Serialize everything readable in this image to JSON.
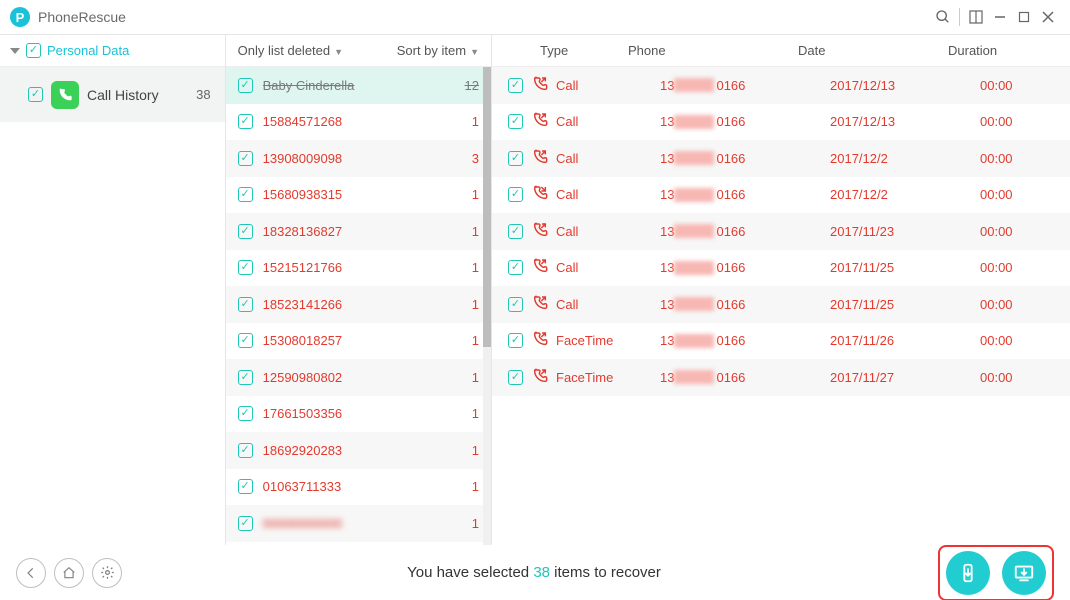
{
  "app": {
    "title": "PhoneRescue"
  },
  "sidebar": {
    "root_label": "Personal Data",
    "item": {
      "label": "Call History",
      "count": "38"
    }
  },
  "middle": {
    "filter_label": "Only list deleted",
    "sort_label": "Sort by item",
    "rows": [
      {
        "name": "Baby Cinderella",
        "count": "12",
        "selected": true
      },
      {
        "name": "15884571268",
        "count": "1"
      },
      {
        "name": "13908009098",
        "count": "3"
      },
      {
        "name": "15680938315",
        "count": "1"
      },
      {
        "name": "18328136827",
        "count": "1"
      },
      {
        "name": "15215121766",
        "count": "1"
      },
      {
        "name": "18523141266",
        "count": "1"
      },
      {
        "name": "15308018257",
        "count": "1"
      },
      {
        "name": "12590980802",
        "count": "1"
      },
      {
        "name": "17661503356",
        "count": "1"
      },
      {
        "name": "18692920283",
        "count": "1"
      },
      {
        "name": "01063711333",
        "count": "1"
      },
      {
        "name": "",
        "count": "1",
        "blurred": true
      }
    ]
  },
  "detail": {
    "headers": {
      "type": "Type",
      "phone": "Phone",
      "date": "Date",
      "duration": "Duration"
    },
    "rows": [
      {
        "type": "Call",
        "dir": "out",
        "pfx": "13",
        "sfx": "0166",
        "date": "2017/12/13",
        "dur": "00:00"
      },
      {
        "type": "Call",
        "dir": "out",
        "pfx": "13",
        "sfx": "0166",
        "date": "2017/12/13",
        "dur": "00:00"
      },
      {
        "type": "Call",
        "dir": "out",
        "pfx": "13",
        "sfx": "0166",
        "date": "2017/12/2",
        "dur": "00:00"
      },
      {
        "type": "Call",
        "dir": "missed",
        "pfx": "13",
        "sfx": "0166",
        "date": "2017/12/2",
        "dur": "00:00"
      },
      {
        "type": "Call",
        "dir": "out",
        "pfx": "13",
        "sfx": "0166",
        "date": "2017/11/23",
        "dur": "00:00"
      },
      {
        "type": "Call",
        "dir": "out",
        "pfx": "13",
        "sfx": "0166",
        "date": "2017/11/25",
        "dur": "00:00"
      },
      {
        "type": "Call",
        "dir": "out",
        "pfx": "13",
        "sfx": "0166",
        "date": "2017/11/25",
        "dur": "00:00"
      },
      {
        "type": "FaceTime",
        "dir": "out",
        "pfx": "13",
        "sfx": "0166",
        "date": "2017/11/26",
        "dur": "00:00"
      },
      {
        "type": "FaceTime",
        "dir": "out",
        "pfx": "13",
        "sfx": "0166",
        "date": "2017/11/27",
        "dur": "00:00"
      }
    ]
  },
  "footer": {
    "msg_a": "You have selected ",
    "count": "38",
    "msg_b": " items to recover"
  }
}
